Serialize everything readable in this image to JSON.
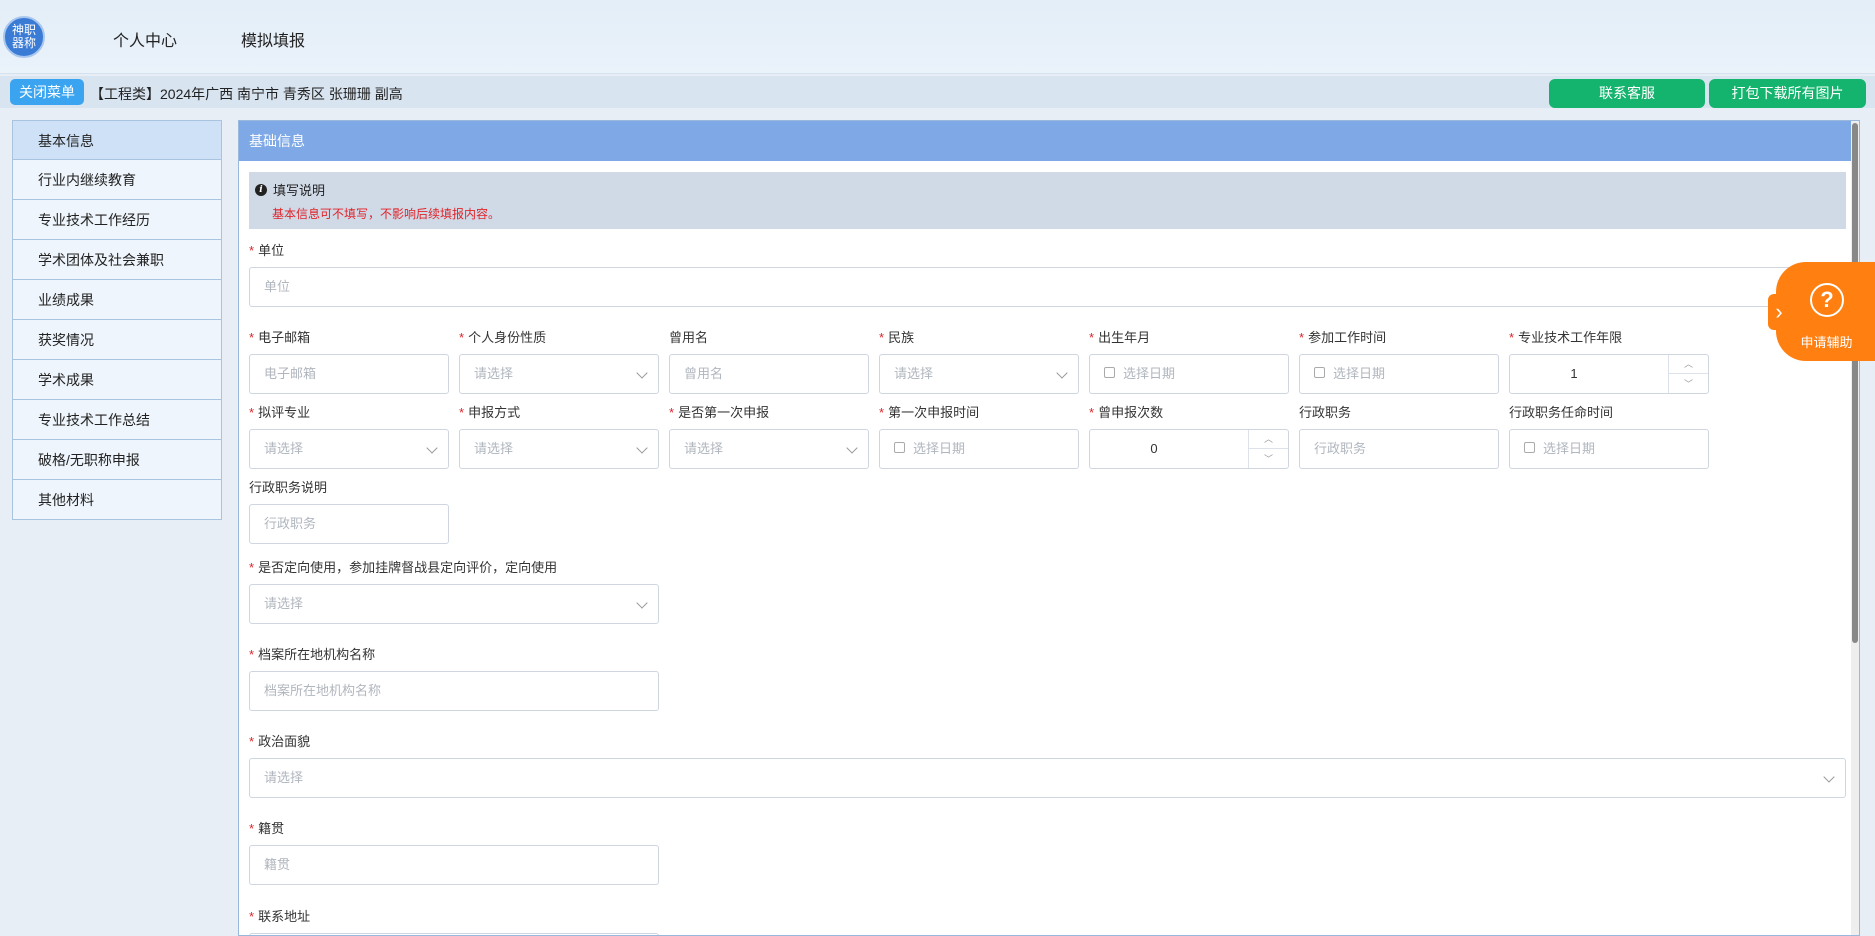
{
  "logo": {
    "text": "神职器称"
  },
  "nav": [
    "个人中心",
    "模拟填报"
  ],
  "subbar": {
    "close_menu": "关闭菜单",
    "breadcrumb": "【工程类】2024年广西 南宁市 青秀区 张珊珊 副高",
    "contact": "联系客服",
    "download": "打包下载所有图片"
  },
  "sidebar": {
    "items": [
      {
        "label": "基本信息"
      },
      {
        "label": "行业内继续教育"
      },
      {
        "label": "专业技术工作经历"
      },
      {
        "label": "学术团体及社会兼职"
      },
      {
        "label": "业绩成果"
      },
      {
        "label": "获奖情况"
      },
      {
        "label": "学术成果"
      },
      {
        "label": "专业技术工作总结"
      },
      {
        "label": "破格/无职称申报"
      },
      {
        "label": "其他材料"
      }
    ]
  },
  "panel": {
    "title": "基础信息",
    "notice_title": "填写说明",
    "notice_msg": "基本信息可不填写，不影响后续填报内容。"
  },
  "form": {
    "unit": {
      "label": "单位",
      "placeholder": "单位"
    },
    "email": {
      "label": "电子邮箱",
      "placeholder": "电子邮箱"
    },
    "identity": {
      "label": "个人身份性质",
      "placeholder": "请选择"
    },
    "former_name": {
      "label": "曾用名",
      "placeholder": "曾用名"
    },
    "ethnicity": {
      "label": "民族",
      "placeholder": "请选择"
    },
    "birth": {
      "label": "出生年月",
      "placeholder": "选择日期"
    },
    "work_start": {
      "label": "参加工作时间",
      "placeholder": "选择日期"
    },
    "years": {
      "label": "专业技术工作年限",
      "value": "1"
    },
    "major": {
      "label": "拟评专业",
      "placeholder": "请选择"
    },
    "method": {
      "label": "申报方式",
      "placeholder": "请选择"
    },
    "first_time": {
      "label": "是否第一次申报",
      "placeholder": "请选择"
    },
    "first_date": {
      "label": "第一次申报时间",
      "placeholder": "选择日期"
    },
    "count": {
      "label": "曾申报次数",
      "value": "0"
    },
    "admin_post": {
      "label": "行政职务",
      "placeholder": "行政职务"
    },
    "admin_date": {
      "label": "行政职务任命时间",
      "placeholder": "选择日期"
    },
    "admin_desc": {
      "label": "行政职务说明",
      "placeholder": "行政职务"
    },
    "directed": {
      "label": "是否定向使用，参加挂牌督战县定向评价，定向使用",
      "placeholder": "请选择"
    },
    "archive": {
      "label": "档案所在地机构名称",
      "placeholder": "档案所在地机构名称"
    },
    "politics": {
      "label": "政治面貌",
      "placeholder": "请选择"
    },
    "native": {
      "label": "籍贯",
      "placeholder": "籍贯"
    },
    "address": {
      "label": "联系地址"
    }
  },
  "helper": {
    "label": "申请辅助",
    "icon": "question-circle-icon"
  }
}
